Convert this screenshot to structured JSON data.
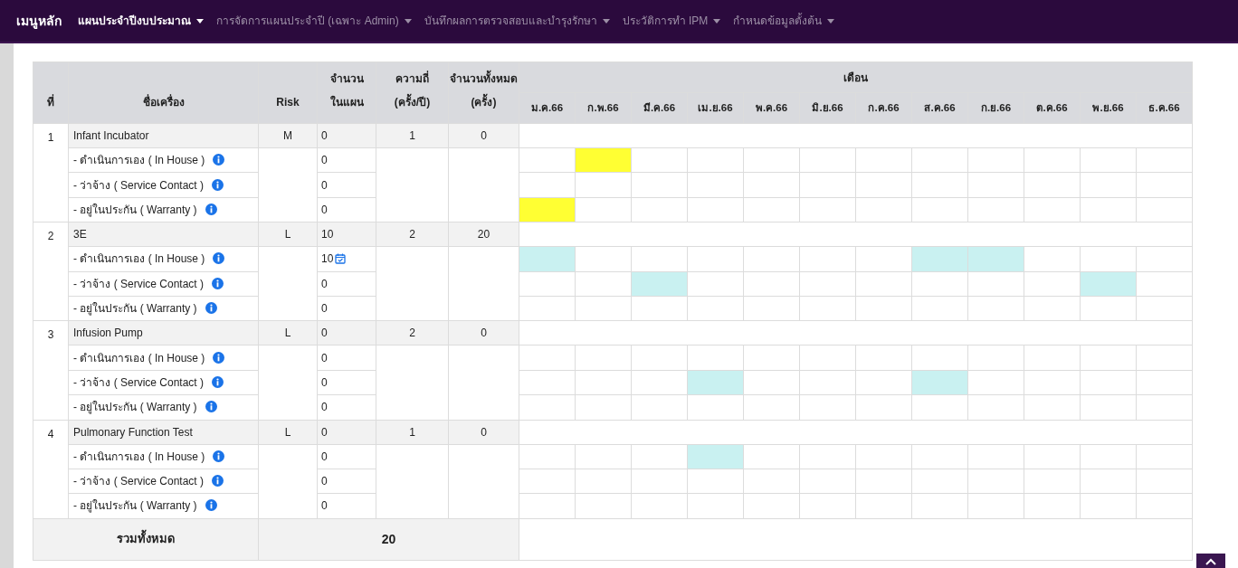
{
  "navbar": {
    "brand": "เมนูหลัก",
    "items": [
      {
        "label": "แผนประจำปีงบประมาณ",
        "selected": true
      },
      {
        "label": "การจัดการแผนประจำปี (เฉพาะ Admin)",
        "selected": false
      },
      {
        "label": "บันทึกผลการตรวจสอบและบำรุงรักษา",
        "selected": false
      },
      {
        "label": "ประวัติการทำ IPM",
        "selected": false
      },
      {
        "label": "กำหนดข้อมูลตั้งต้น",
        "selected": false
      }
    ]
  },
  "table": {
    "columns": [
      "ที่",
      "ชื่อเครื่อง",
      "Risk",
      "จำนวน ในแผน",
      "ความถี่ (ครั้ง/ปี)",
      "จำนวนทั้งหมด (ครั้ง)"
    ],
    "month_group": "เดือน",
    "months": [
      "ม.ค.66",
      "ก.พ.66",
      "มี.ค.66",
      "เม.ย.66",
      "พ.ค.66",
      "มิ.ย.66",
      "ก.ค.66",
      "ส.ค.66",
      "ก.ย.66",
      "ต.ค.66",
      "พ.ย.66",
      "ธ.ค.66"
    ],
    "items": [
      {
        "no": "1",
        "name": "Infant Incubator",
        "risk": "M",
        "planned": "0",
        "frequency": "1",
        "total": "0",
        "color": "#ffff33",
        "rows": [
          {
            "label": "- ดำเนินการเอง ( In House )",
            "planned": "0",
            "scheduled": false,
            "months": [
              false,
              true,
              false,
              false,
              false,
              false,
              false,
              false,
              false,
              false,
              false,
              false
            ]
          },
          {
            "label": "- ว่าจ้าง ( Service Contact )",
            "planned": "0",
            "scheduled": false,
            "months": [
              false,
              false,
              false,
              false,
              false,
              false,
              false,
              false,
              false,
              false,
              false,
              false
            ]
          },
          {
            "label": "- อยู่ในประกัน ( Warranty )",
            "planned": "0",
            "scheduled": false,
            "months": [
              true,
              false,
              false,
              false,
              false,
              false,
              false,
              false,
              false,
              false,
              false,
              false
            ]
          }
        ]
      },
      {
        "no": "2",
        "name": "3E",
        "risk": "L",
        "planned": "10",
        "frequency": "2",
        "total": "20",
        "color": "#c9f1f1",
        "rows": [
          {
            "label": "- ดำเนินการเอง ( In House )",
            "planned": "10",
            "scheduled": true,
            "months": [
              true,
              false,
              false,
              false,
              false,
              false,
              false,
              true,
              true,
              false,
              false,
              false
            ]
          },
          {
            "label": "- ว่าจ้าง ( Service Contact )",
            "planned": "0",
            "scheduled": false,
            "months": [
              false,
              false,
              true,
              false,
              false,
              false,
              false,
              false,
              false,
              false,
              true,
              false
            ]
          },
          {
            "label": "- อยู่ในประกัน ( Warranty )",
            "planned": "0",
            "scheduled": false,
            "months": [
              false,
              false,
              false,
              false,
              false,
              false,
              false,
              false,
              false,
              false,
              false,
              false
            ]
          }
        ]
      },
      {
        "no": "3",
        "name": "Infusion Pump",
        "risk": "L",
        "planned": "0",
        "frequency": "2",
        "total": "0",
        "color": "#c9f1f1",
        "rows": [
          {
            "label": "- ดำเนินการเอง ( In House )",
            "planned": "0",
            "scheduled": false,
            "months": [
              false,
              false,
              false,
              false,
              false,
              false,
              false,
              false,
              false,
              false,
              false,
              false
            ]
          },
          {
            "label": "- ว่าจ้าง ( Service Contact )",
            "planned": "0",
            "scheduled": false,
            "months": [
              false,
              false,
              false,
              true,
              false,
              false,
              false,
              true,
              false,
              false,
              false,
              false
            ]
          },
          {
            "label": "- อยู่ในประกัน ( Warranty )",
            "planned": "0",
            "scheduled": false,
            "months": [
              false,
              false,
              false,
              false,
              false,
              false,
              false,
              false,
              false,
              false,
              false,
              false
            ]
          }
        ]
      },
      {
        "no": "4",
        "name": "Pulmonary Function Test",
        "risk": "L",
        "planned": "0",
        "frequency": "1",
        "total": "0",
        "color": "#c9f1f1",
        "rows": [
          {
            "label": "- ดำเนินการเอง ( In House )",
            "planned": "0",
            "scheduled": false,
            "months": [
              false,
              false,
              false,
              true,
              false,
              false,
              false,
              false,
              false,
              false,
              false,
              false
            ]
          },
          {
            "label": "- ว่าจ้าง ( Service Contact )",
            "planned": "0",
            "scheduled": false,
            "months": [
              false,
              false,
              false,
              false,
              false,
              false,
              false,
              false,
              false,
              false,
              false,
              false
            ]
          },
          {
            "label": "- อยู่ในประกัน ( Warranty )",
            "planned": "0",
            "scheduled": false,
            "months": [
              false,
              false,
              false,
              false,
              false,
              false,
              false,
              false,
              false,
              false,
              false,
              false
            ]
          }
        ]
      }
    ],
    "footer": {
      "label": "รวมทั้งหมด",
      "total": "20"
    }
  }
}
